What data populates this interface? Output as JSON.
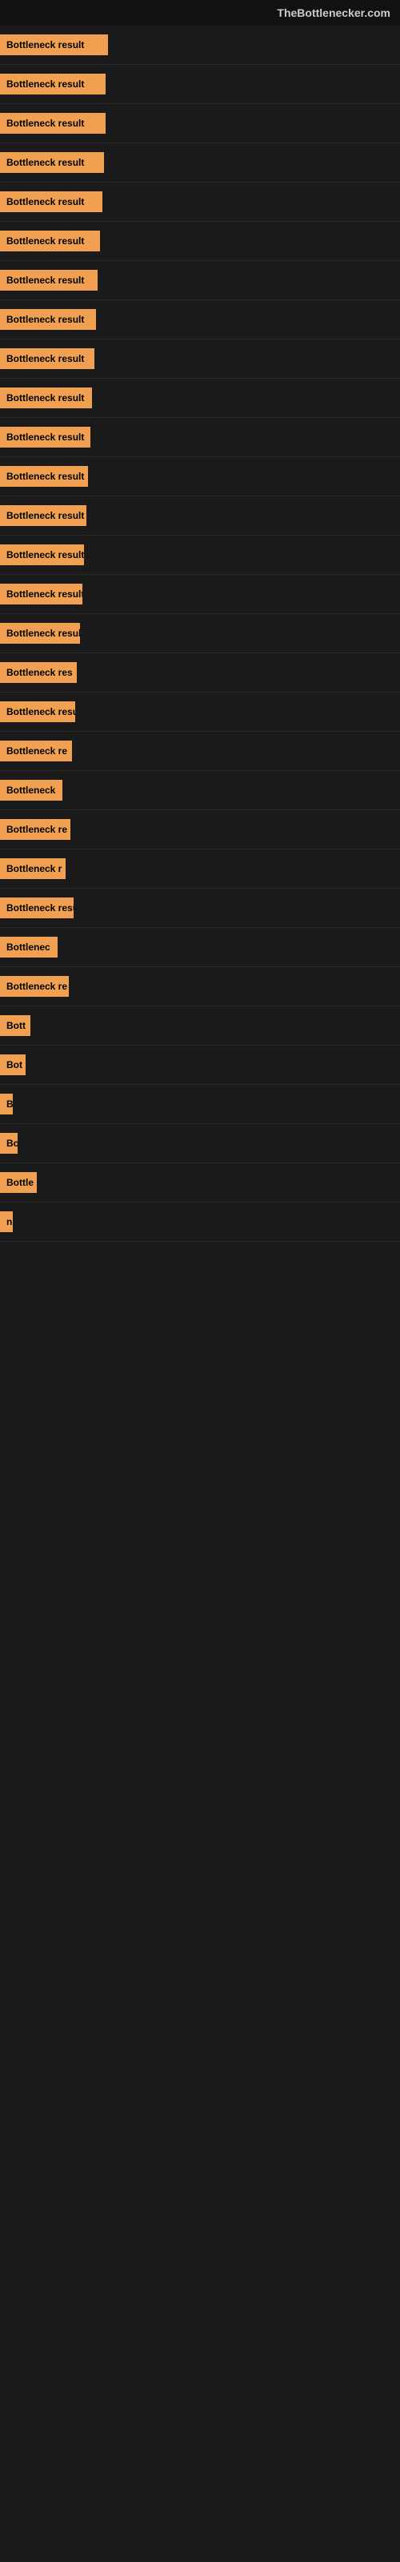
{
  "site": {
    "title": "TheBottlenecker.com"
  },
  "bars": [
    {
      "label": "Bottleneck result",
      "width": 135,
      "marginTop": 0
    },
    {
      "label": "Bottleneck result",
      "width": 132,
      "marginTop": 0
    },
    {
      "label": "Bottleneck result",
      "width": 132,
      "marginTop": 0
    },
    {
      "label": "Bottleneck result",
      "width": 130,
      "marginTop": 0
    },
    {
      "label": "Bottleneck result",
      "width": 128,
      "marginTop": 0
    },
    {
      "label": "Bottleneck result",
      "width": 125,
      "marginTop": 0
    },
    {
      "label": "Bottleneck result",
      "width": 122,
      "marginTop": 0
    },
    {
      "label": "Bottleneck result",
      "width": 120,
      "marginTop": 0
    },
    {
      "label": "Bottleneck result",
      "width": 118,
      "marginTop": 0
    },
    {
      "label": "Bottleneck result",
      "width": 115,
      "marginTop": 0
    },
    {
      "label": "Bottleneck result",
      "width": 113,
      "marginTop": 0
    },
    {
      "label": "Bottleneck result",
      "width": 110,
      "marginTop": 0
    },
    {
      "label": "Bottleneck result",
      "width": 108,
      "marginTop": 0
    },
    {
      "label": "Bottleneck result",
      "width": 105,
      "marginTop": 0
    },
    {
      "label": "Bottleneck result",
      "width": 103,
      "marginTop": 0
    },
    {
      "label": "Bottleneck result",
      "width": 100,
      "marginTop": 0
    },
    {
      "label": "Bottleneck res",
      "width": 96,
      "marginTop": 0
    },
    {
      "label": "Bottleneck result",
      "width": 94,
      "marginTop": 0
    },
    {
      "label": "Bottleneck re",
      "width": 90,
      "marginTop": 0
    },
    {
      "label": "Bottleneck",
      "width": 78,
      "marginTop": 0
    },
    {
      "label": "Bottleneck re",
      "width": 88,
      "marginTop": 0
    },
    {
      "label": "Bottleneck r",
      "width": 82,
      "marginTop": 0
    },
    {
      "label": "Bottleneck resu",
      "width": 92,
      "marginTop": 0
    },
    {
      "label": "Bottlenec",
      "width": 72,
      "marginTop": 0
    },
    {
      "label": "Bottleneck re",
      "width": 86,
      "marginTop": 0
    },
    {
      "label": "Bott",
      "width": 38,
      "marginTop": 0
    },
    {
      "label": "Bot",
      "width": 32,
      "marginTop": 0
    },
    {
      "label": "B",
      "width": 14,
      "marginTop": 0
    },
    {
      "label": "Bo",
      "width": 22,
      "marginTop": 0
    },
    {
      "label": "Bottle",
      "width": 46,
      "marginTop": 0
    },
    {
      "label": "n",
      "width": 10,
      "marginTop": 0
    }
  ]
}
